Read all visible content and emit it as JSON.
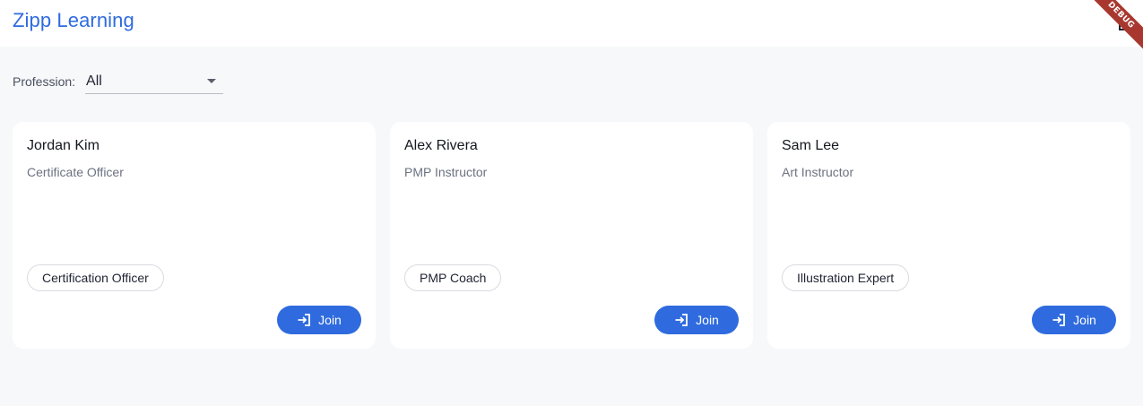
{
  "app": {
    "title": "Zipp Learning",
    "debug_banner": "DEBUG",
    "action_icon": "document-icon"
  },
  "filter": {
    "label": "Profession:",
    "selected": "All"
  },
  "colors": {
    "primary": "#2f6bde",
    "background": "#f7f8fa",
    "card": "#ffffff",
    "debug_ribbon": "#a8382f"
  },
  "instructors": [
    {
      "name": "Jordan Kim",
      "role": "Certificate Officer",
      "tag": "Certification Officer",
      "action": "Join"
    },
    {
      "name": "Alex Rivera",
      "role": "PMP Instructor",
      "tag": "PMP Coach",
      "action": "Join"
    },
    {
      "name": "Sam Lee",
      "role": "Art Instructor",
      "tag": "Illustration Expert",
      "action": "Join"
    }
  ]
}
